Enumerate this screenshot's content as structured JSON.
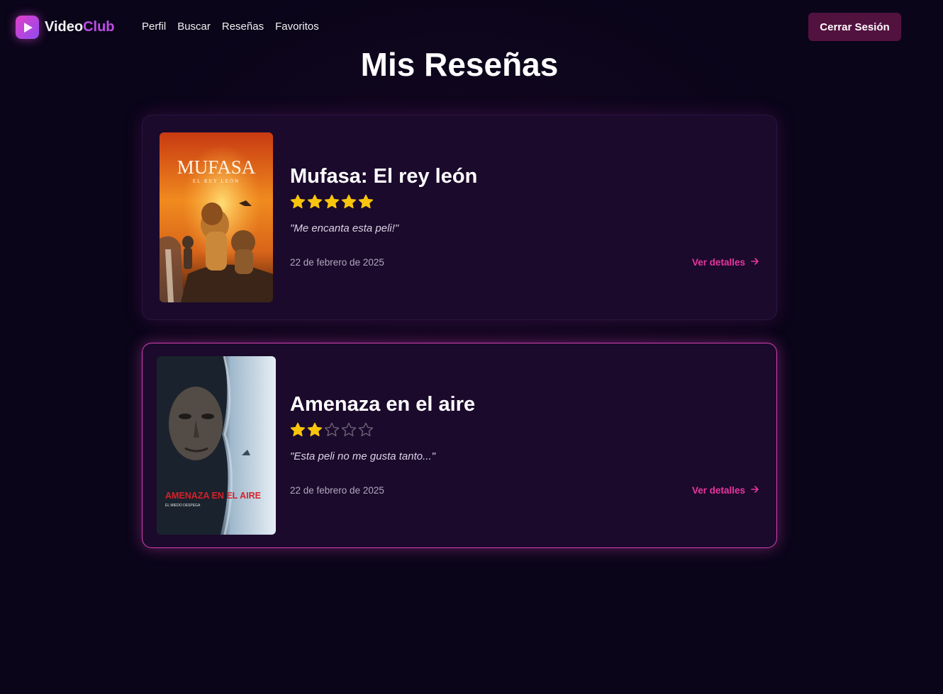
{
  "app": {
    "logo_part1": "Video",
    "logo_part2": "Club",
    "nav": [
      "Perfil",
      "Buscar",
      "Reseñas",
      "Favoritos"
    ],
    "logout_label": "Cerrar Sesión",
    "accent_color": "#e8359f",
    "logout_color": "#52123f"
  },
  "page": {
    "title": "Mis Reseñas"
  },
  "reviews": [
    {
      "title": "Mufasa: El rey león",
      "rating": 5,
      "max_rating": 5,
      "comment": "\"Me encanta esta peli!\"",
      "date": "22 de febrero de 2025",
      "details_label": "Ver detalles",
      "poster": {
        "title": "MUFASA",
        "subtitle": "EL REY LEÓN"
      }
    },
    {
      "title": "Amenaza en el aire",
      "rating": 2,
      "max_rating": 5,
      "comment": "\"Esta peli no me gusta tanto...\"",
      "date": "22 de febrero de 2025",
      "details_label": "Ver detalles",
      "poster": {
        "title": "AMENAZA EN EL AIRE",
        "subtitle": "EL MIEDO DESPEGA"
      }
    }
  ]
}
